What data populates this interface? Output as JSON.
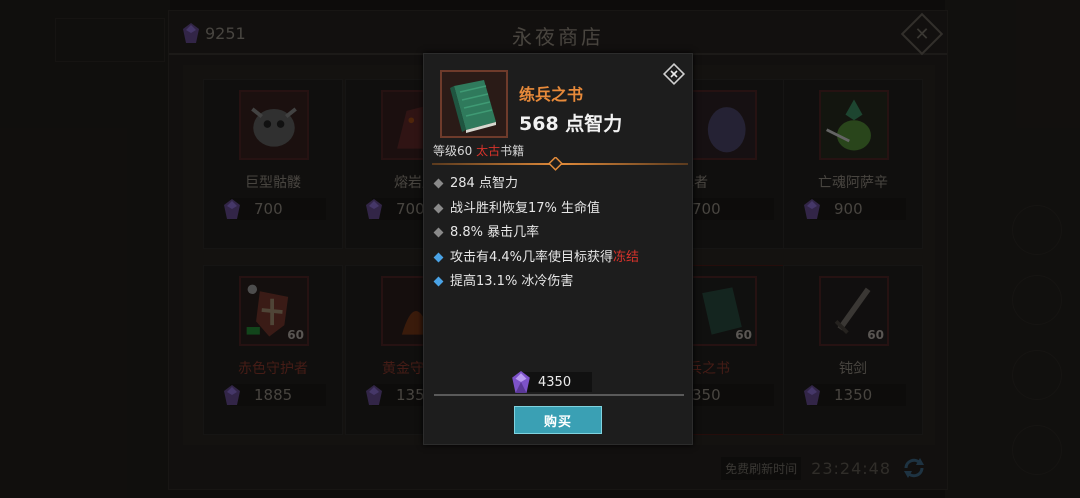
{
  "shop": {
    "gem_total": "9251",
    "title": "永夜商店",
    "refresh_label": "免费刷新时间",
    "refresh_timer": "23:24:48",
    "items": [
      {
        "name": "巨型骷髅",
        "price": "700",
        "level": ""
      },
      {
        "name": "熔岩魔",
        "price": "700",
        "level": ""
      },
      {
        "name": "",
        "price": "",
        "level": ""
      },
      {
        "name": "喷冰者",
        "price": "700",
        "level": ""
      },
      {
        "name": "亡魂阿萨辛",
        "price": "900",
        "level": ""
      },
      {
        "name": "赤色守护者",
        "price": "1885",
        "level": "60"
      },
      {
        "name": "黄金守",
        "price": "135",
        "level": ""
      },
      {
        "name": "",
        "price": "",
        "level": ""
      },
      {
        "name": "兵之书",
        "price": "350",
        "level": "60"
      },
      {
        "name": "钝剑",
        "price": "1350",
        "level": "60"
      }
    ]
  },
  "popup": {
    "name": "练兵之书",
    "main_stat": "568 点智力",
    "level_prefix": "等级60",
    "rarity": "太古",
    "category": "书籍",
    "stats": [
      {
        "text": "284 点智力",
        "bullet": "grey"
      },
      {
        "text": "战斗胜利恢复17% 生命值",
        "bullet": "grey"
      },
      {
        "text": "8.8% 暴击几率",
        "bullet": "grey"
      },
      {
        "text_before": "攻击有4.4%几率使目标获得",
        "highlight": "冻结",
        "bullet": "blue"
      },
      {
        "text": "提高13.1% 冰冷伤害",
        "bullet": "blue"
      }
    ],
    "cost": "4350",
    "buy_label": "购买"
  },
  "colors": {
    "name_orange": "#e88a3a",
    "rarity_red": "#d7332b",
    "buy_button": "#3aa0b4",
    "gem_purple": "#8a5cd6"
  }
}
